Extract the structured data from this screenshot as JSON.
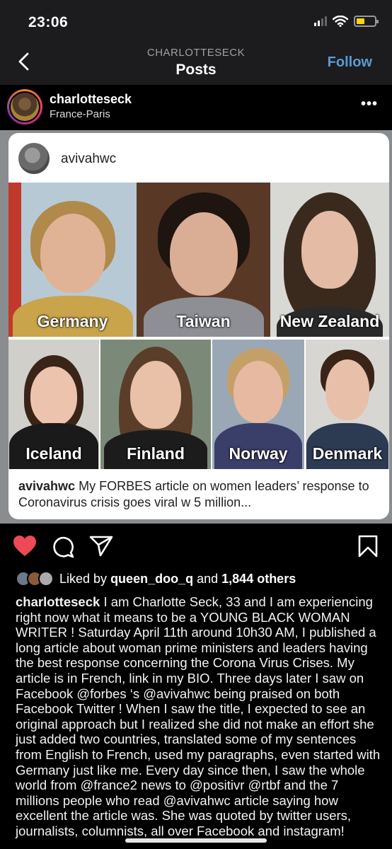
{
  "status_bar": {
    "time": "23:06",
    "icons": [
      "signal-icon",
      "wifi-icon",
      "battery-icon"
    ],
    "battery_color": "#ffd60a"
  },
  "nav": {
    "subtitle": "CHARLOTTESECK",
    "title": "Posts",
    "follow_label": "Follow",
    "follow_color": "#5b9bd5"
  },
  "post": {
    "username": "charlotteseck",
    "location": "France-Paris",
    "more_label": "•••"
  },
  "embedded_card": {
    "username": "avivahwc",
    "tiles": [
      {
        "label": "Germany"
      },
      {
        "label": "Taiwan"
      },
      {
        "label": "New Zealand"
      },
      {
        "label": "Iceland"
      },
      {
        "label": "Finland"
      },
      {
        "label": "Norway"
      },
      {
        "label": "Denmark"
      }
    ],
    "caption_user": "avivahwc",
    "caption_text": "My FORBES article on women leaders’ response to Coronavirus crisis goes viral w 5 million..."
  },
  "actions": {
    "liked": true,
    "heart_color": "#ed4956",
    "icons": [
      "heart-icon",
      "comment-icon",
      "share-icon",
      "bookmark-icon"
    ]
  },
  "likes": {
    "prefix": "Liked by",
    "user": "queen_doo_q",
    "middle": "and",
    "count": "1,844 others"
  },
  "caption": {
    "user": "charlotteseck",
    "text": "I am Charlotte Seck, 33 and I am experiencing right now what it means to be a YOUNG BLACK WOMAN WRITER ! Saturday April 11th around 10h30 AM, I published a long article about woman prime ministers and leaders having the best response concerning the Corona Virus Crises. My article is in French, link in my BIO. Three days later I saw on Facebook @forbes ‘s @avivahwc being praised on both Facebook Twitter ! When I saw the title, I expected to see an original approach but I realized she did not make an effort she just added two countries, translated some of my sentences from English to French, used my paragraphs, even started with Germany just like me. Every day since then, I saw the whole world from @france2 news to @positivr @rtbf and the 7 millions people who read @avivahwc article saying how excellent the article was. She was quoted by twitter users, journalists, columnists, all over Facebook and instagram!"
  }
}
